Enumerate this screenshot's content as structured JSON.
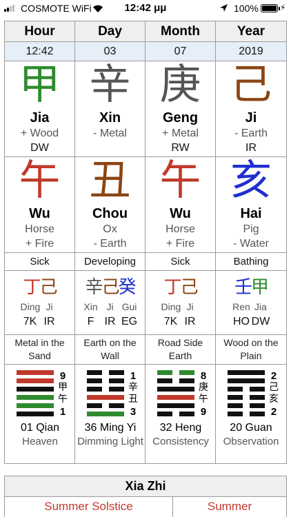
{
  "status_bar": {
    "carrier": "COSMOTE WiFi",
    "time": "12:42 μμ",
    "battery": "100%",
    "icons": [
      "signal-icon",
      "wifi-icon",
      "location-arrow-icon",
      "battery-icon",
      "charging-icon"
    ]
  },
  "colors": {
    "wood": "#2e8b2e",
    "fire": "#c0392b",
    "earth": "#8b4513",
    "metal": "#555555",
    "water": "#1f2fcf",
    "yin_line": "#111111"
  },
  "pillars": {
    "headers": [
      "Hour",
      "Day",
      "Month",
      "Year"
    ],
    "dates": [
      "12:42",
      "03",
      "07",
      "2019"
    ],
    "stems": [
      {
        "char": "甲",
        "pinyin": "Jia",
        "element": "+ Wood",
        "god": "DW",
        "color": "#2e8b2e"
      },
      {
        "char": "辛",
        "pinyin": "Xin",
        "element": "- Metal",
        "god": "",
        "color": "#555555"
      },
      {
        "char": "庚",
        "pinyin": "Geng",
        "element": "+ Metal",
        "god": "RW",
        "color": "#555555"
      },
      {
        "char": "己",
        "pinyin": "Ji",
        "element": "- Earth",
        "god": "IR",
        "color": "#8b4513"
      }
    ],
    "branches": [
      {
        "char": "午",
        "pinyin": "Wu",
        "animal": "Horse",
        "element": "+ Fire",
        "color": "#c0392b"
      },
      {
        "char": "丑",
        "pinyin": "Chou",
        "animal": "Ox",
        "element": "- Earth",
        "color": "#8b4513"
      },
      {
        "char": "午",
        "pinyin": "Wu",
        "animal": "Horse",
        "element": "+ Fire",
        "color": "#c0392b"
      },
      {
        "char": "亥",
        "pinyin": "Hai",
        "animal": "Pig",
        "element": "- Water",
        "color": "#1f2fcf"
      }
    ],
    "life_stages": [
      "Sick",
      "Developing",
      "Sick",
      "Bathing"
    ],
    "hidden_stems": [
      [
        {
          "char": "丁",
          "pinyin": "Ding",
          "god": "7K",
          "color": "#c0392b"
        },
        {
          "char": "己",
          "pinyin": "Ji",
          "god": "IR",
          "color": "#8b4513"
        }
      ],
      [
        {
          "char": "辛",
          "pinyin": "Xin",
          "god": "F",
          "color": "#555555"
        },
        {
          "char": "己",
          "pinyin": "Ji",
          "god": "IR",
          "color": "#8b4513"
        },
        {
          "char": "癸",
          "pinyin": "Gui",
          "god": "EG",
          "color": "#1f2fcf"
        }
      ],
      [
        {
          "char": "丁",
          "pinyin": "Ding",
          "god": "7K",
          "color": "#c0392b"
        },
        {
          "char": "己",
          "pinyin": "Ji",
          "god": "IR",
          "color": "#8b4513"
        }
      ],
      [
        {
          "char": "壬",
          "pinyin": "Ren",
          "god": "HO",
          "color": "#1f2fcf"
        },
        {
          "char": "甲",
          "pinyin": "Jia",
          "god": "DW",
          "color": "#2e8b2e"
        }
      ]
    ],
    "nayin": [
      [
        "Metal in the",
        "Sand"
      ],
      [
        "Earth on the",
        "Wall"
      ],
      [
        "Road Side",
        "Earth"
      ],
      [
        "Wood on the",
        "Plain"
      ]
    ],
    "hexagrams": [
      {
        "title": "01 Qian",
        "name": "Heaven",
        "lines": [
          {
            "type": "yang",
            "color": "#c0392b"
          },
          {
            "type": "yang",
            "color": "#c0392b"
          },
          {
            "type": "yang",
            "color": "#111111"
          },
          {
            "type": "yang",
            "color": "#2e8b2e"
          },
          {
            "type": "yang",
            "color": "#2e8b2e"
          },
          {
            "type": "yang",
            "color": "#111111"
          }
        ],
        "tags": [
          "9",
          "甲",
          "午",
          "1"
        ],
        "tag_kinds": [
          "num",
          "cn",
          "cn",
          "num"
        ]
      },
      {
        "title": "36 Ming Yi",
        "name": "Dimming Light",
        "lines": [
          {
            "type": "yin",
            "color": "#111111"
          },
          {
            "type": "yin",
            "color": "#111111"
          },
          {
            "type": "yin",
            "color": "#111111"
          },
          {
            "type": "yang",
            "color": "#c0392b"
          },
          {
            "type": "yin",
            "color": "#111111"
          },
          {
            "type": "yang",
            "color": "#2e8b2e"
          }
        ],
        "tags": [
          "1",
          "辛",
          "丑",
          "3"
        ],
        "tag_kinds": [
          "num",
          "cn",
          "cn",
          "num"
        ]
      },
      {
        "title": "32 Heng",
        "name": "Consistency",
        "lines": [
          {
            "type": "yin",
            "color": "#2e8b2e"
          },
          {
            "type": "yin",
            "color": "#111111"
          },
          {
            "type": "yang",
            "color": "#111111"
          },
          {
            "type": "yang",
            "color": "#c0392b"
          },
          {
            "type": "yang",
            "color": "#111111"
          },
          {
            "type": "yin",
            "color": "#111111"
          }
        ],
        "tags": [
          "8",
          "庚",
          "午",
          "9"
        ],
        "tag_kinds": [
          "num",
          "cn",
          "cn",
          "num"
        ]
      },
      {
        "title": "20 Guan",
        "name": "Observation",
        "lines": [
          {
            "type": "yang",
            "color": "#111111"
          },
          {
            "type": "yang",
            "color": "#111111"
          },
          {
            "type": "yin",
            "color": "#111111"
          },
          {
            "type": "yin",
            "color": "#111111"
          },
          {
            "type": "yin",
            "color": "#111111"
          },
          {
            "type": "yin",
            "color": "#111111"
          }
        ],
        "tags": [
          "2",
          "己",
          "亥",
          "2"
        ],
        "tag_kinds": [
          "num",
          "cn",
          "cn",
          "num"
        ]
      }
    ]
  },
  "solar_term": {
    "title": "Xia Zhi",
    "english": "Summer Solstice",
    "season": "Summer"
  }
}
